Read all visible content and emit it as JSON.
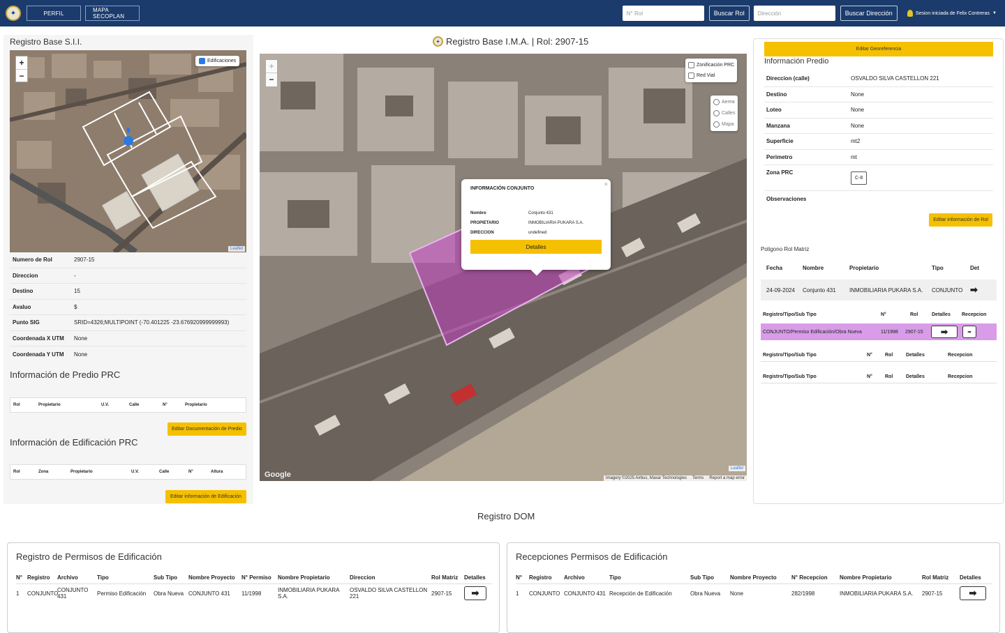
{
  "topbar": {
    "nav": [
      "PERFIL",
      "MAPA SECOPLAN"
    ],
    "rol_placeholder": "N° Rol",
    "buscar_rol": "Buscar Rol",
    "direccion_placeholder": "Dirección",
    "buscar_direccion": "Buscar Dirección",
    "session": "Sesion iniciada de Felix Contreras"
  },
  "left": {
    "title": "Registro Base S.I.I.",
    "layer_label": "Edificaciones",
    "leaflet": "Leaflet",
    "fields": [
      {
        "k": "Numero de Rol",
        "v": "2907-15"
      },
      {
        "k": "Direccion",
        "v": "-"
      },
      {
        "k": "Destino",
        "v": "15"
      },
      {
        "k": "Avaluo",
        "v": "$"
      },
      {
        "k": "Punto SIG",
        "v": "SRID=4326;MULTIPOINT (-70.401225 -23.676920999999993)"
      },
      {
        "k": "Coordenada X UTM",
        "v": "None"
      },
      {
        "k": "Coordenada Y UTM",
        "v": "None"
      }
    ],
    "prc_title": "Información de Predio PRC",
    "prc_cols": [
      "Rol",
      "Propietario",
      "U.V.",
      "Calle",
      "N°",
      "Propietario"
    ],
    "prc_btn": "Editar Documentación de Predio",
    "edif_title": "Información de Edificación PRC",
    "edif_cols": [
      "Rol",
      "Zona",
      "Propietario",
      "U.V.",
      "Calle",
      "N°",
      "Altura"
    ],
    "edif_btn": "Editar información de Edificación"
  },
  "center": {
    "title": "Registro Base I.M.A. | Rol: 2907-15",
    "layers_check": [
      "Zonificación PRC",
      "Red Vial"
    ],
    "layers_radio": [
      "Aerea",
      "Calles",
      "Mapa"
    ],
    "popup": {
      "title": "INFORMACIÓN CONJUNTO",
      "rows": [
        {
          "k": "Nombre",
          "v": "Conjunto 431"
        },
        {
          "k": "PROPIETARIO",
          "v": "INMOBILIARIA PUKARA S.A."
        },
        {
          "k": "DIRECCION",
          "v": "undefined"
        }
      ],
      "button": "Detalles"
    },
    "google": "Google",
    "leaflet": "Leaflet",
    "imagery": "Imagery ©2025 Airbus, Maxar Technologies",
    "terms": "Terms",
    "report": "Report a map error"
  },
  "right": {
    "edit_geo": "Editar Georeferencia",
    "info_title": "Información Predio",
    "fields": [
      {
        "k": "Direccion (calle)",
        "v": "OSVALDO SILVA CASTELLON 221"
      },
      {
        "k": "Destino",
        "v": "None"
      },
      {
        "k": "Loteo",
        "v": "None"
      },
      {
        "k": "Manzana",
        "v": "None"
      },
      {
        "k": "Superficie",
        "v": "mt2"
      },
      {
        "k": "Perimetro",
        "v": "mt"
      }
    ],
    "zona_label": "Zona PRC",
    "zona_value": "C-8",
    "obs_label": "Observaciones",
    "edit_rol": "Editar información de Rol",
    "poligono": "Poligono Rol Matriz",
    "poly_cols": [
      "Fecha",
      "Nombre",
      "Propietario",
      "Tipo",
      "Det"
    ],
    "poly_row": [
      "24-09-2024",
      "Conjunto 431",
      "INMOBILIARIA PUKARA S.A.",
      "CONJUNTO"
    ],
    "reg_cols": [
      "Registro/Tipo/Sub Tipo",
      "N°",
      "Rol",
      "Detalles",
      "Recepcion"
    ],
    "reg_row": [
      "CONJUNTO/Permiso Edificación/Obra Nueva",
      "11/1998",
      "2907-15"
    ],
    "reg_cols2": [
      "Registro/Tipo/Sub Tipo",
      "N°",
      "Rol",
      "Detalles",
      "Recepcion"
    ],
    "reg_cols3": [
      "Registro/Tipo/Sub Tipo",
      "N°",
      "Rol",
      "Detalles",
      "Recepcion"
    ]
  },
  "dom": {
    "title": "Registro DOM",
    "permisos": {
      "title": "Registro de Permisos de Edificación",
      "cols": [
        "N°",
        "Registro",
        "Archivo",
        "Tipo",
        "Sub Tipo",
        "Nombre Proyecto",
        "N° Permiso",
        "Nombre Propietario",
        "Direccion",
        "Rol Matriz",
        "Detalles"
      ],
      "row": [
        "1",
        "CONJUNTO",
        "CONJUNTO 431",
        "Permiso Edificación",
        "Obra Nueva",
        "CONJUNTO 431",
        "11/1998",
        "INMOBILIARIA PUKARA S.A.",
        "OSVALDO SILVA CASTELLON 221",
        "2907-15"
      ]
    },
    "recepciones": {
      "title": "Recepciones Permisos de Edificación",
      "cols": [
        "N°",
        "Registro",
        "Archivo",
        "Tipo",
        "Sub Tipo",
        "Nombre Proyecto",
        "N° Recepcion",
        "Nombre Propietario",
        "Rol Matriz",
        "Detalles"
      ],
      "row": [
        "1",
        "CONJUNTO",
        "CONJUNTO 431",
        "Recepción de Edificación",
        "Obra Nueva",
        "None",
        "282/1998",
        "INMOBILIARIA PUKARA S.A.",
        "2907-15"
      ]
    }
  },
  "colors": {
    "navbar": "#1a3b6b",
    "accent": "#f5c000",
    "highlight_row": "#d89ce8",
    "polygon": "#c040c0"
  }
}
